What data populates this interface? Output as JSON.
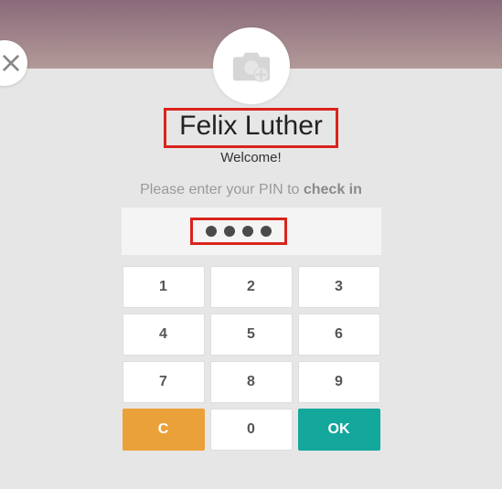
{
  "user": {
    "name": "Felix Luther",
    "welcome": "Welcome!"
  },
  "prompt": {
    "prefix": "Please enter your PIN to ",
    "action": "check in"
  },
  "pin": {
    "entered_count": 4
  },
  "keypad": {
    "keys": [
      "1",
      "2",
      "3",
      "4",
      "5",
      "6",
      "7",
      "8",
      "9"
    ],
    "clear": "C",
    "zero": "0",
    "ok": "OK"
  },
  "colors": {
    "highlight": "#d9241c",
    "clear_btn": "#eaa13a",
    "ok_btn": "#14a89d"
  }
}
